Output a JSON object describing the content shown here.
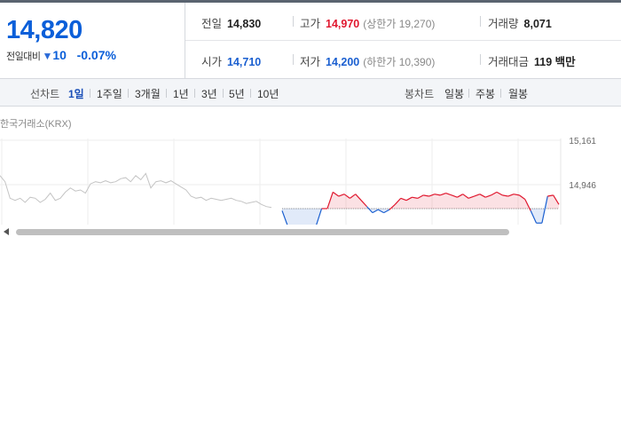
{
  "summary": {
    "price": "14,820",
    "compare_label": "전일대비",
    "change_arrow": "▼",
    "change_value": "10",
    "change_rate": "-0.07%"
  },
  "stats": {
    "prev_close": {
      "label": "전일",
      "value": "14,830"
    },
    "high": {
      "label": "고가",
      "value": "14,970",
      "sub": "(상한가 19,270)"
    },
    "volume": {
      "label": "거래량",
      "value": "8,071"
    },
    "open": {
      "label": "시가",
      "value": "14,710"
    },
    "low": {
      "label": "저가",
      "value": "14,200",
      "sub": "(하한가 10,390)"
    },
    "amount": {
      "label": "거래대금",
      "value": "119 백만"
    }
  },
  "tabs": {
    "line_label": "선차트",
    "line_items": [
      "1일",
      "1주일",
      "3개월",
      "1년",
      "3년",
      "5년",
      "10년"
    ],
    "active": "1일",
    "candle_label": "봉차트",
    "candle_items": [
      "일봉",
      "주봉",
      "월봉"
    ]
  },
  "chart": {
    "market_label": "한국거래소(KRX)",
    "y_labels": [
      "15,161",
      "14,946"
    ],
    "prev_close": 14830,
    "colors": {
      "up": "#e0182f",
      "down": "#1a5fd0",
      "history": "#c4c4c4"
    }
  },
  "chart_data": {
    "type": "line",
    "y_ticks": [
      "15,161",
      "14,946"
    ],
    "ylim": [
      14731,
      15161
    ],
    "baseline": 14830,
    "history_series": [
      14990,
      14960,
      14880,
      14870,
      14880,
      14860,
      14885,
      14880,
      14860,
      14875,
      14905,
      14870,
      14880,
      14910,
      14930,
      14915,
      14920,
      14905,
      14950,
      14960,
      14955,
      14965,
      14955,
      14960,
      14975,
      14980,
      14960,
      14990,
      14970,
      15000,
      14930,
      14960,
      14965,
      14955,
      14965,
      14950,
      14935,
      14920,
      14890,
      14880,
      14885,
      14870,
      14880,
      14875,
      14870,
      14875,
      14880,
      14870,
      14865,
      14855,
      14860,
      14865,
      14850,
      14840,
      14835
    ],
    "today_series": [
      14820,
      14745,
      14745,
      14745,
      14745,
      14745,
      14745,
      14830,
      14830,
      14910,
      14890,
      14900,
      14880,
      14900,
      14870,
      14840,
      14810,
      14825,
      14810,
      14825,
      14850,
      14880,
      14870,
      14885,
      14880,
      14895,
      14890,
      14900,
      14895,
      14905,
      14895,
      14885,
      14900,
      14880,
      14890,
      14900,
      14885,
      14895,
      14910,
      14895,
      14890,
      14900,
      14895,
      14875,
      14820,
      14760,
      14760,
      14890,
      14895,
      14850
    ]
  }
}
